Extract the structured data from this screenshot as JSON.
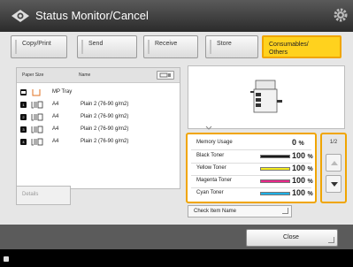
{
  "window": {
    "title": "Status Monitor/Cancel"
  },
  "tabs": [
    {
      "label": "Copy/Print"
    },
    {
      "label": "Send"
    },
    {
      "label": "Receive"
    },
    {
      "label": "Store"
    },
    {
      "label_line1": "Consumables/",
      "label_line2": "Others"
    }
  ],
  "list": {
    "headers": {
      "paper_size": "Paper Size",
      "name": "Name"
    },
    "rows": [
      {
        "num": "",
        "size": "MP Tray",
        "name": ""
      },
      {
        "num": "1",
        "size": "A4",
        "name": "Plain 2 (76-90 g/m2)"
      },
      {
        "num": "2",
        "size": "A4",
        "name": "Plain 2 (76-90 g/m2)"
      },
      {
        "num": "3",
        "size": "A4",
        "name": "Plain 2 (76-90 g/m2)"
      },
      {
        "num": "4",
        "size": "A4",
        "name": "Plain 2 (76-90 g/m2)"
      }
    ]
  },
  "details_label": "Details",
  "consumables": [
    {
      "name": "Memory Usage",
      "value": "0",
      "unit": "%",
      "color": ""
    },
    {
      "name": "Black Toner",
      "value": "100",
      "unit": "%",
      "color": "#1a1a1a"
    },
    {
      "name": "Yellow Toner",
      "value": "100",
      "unit": "%",
      "color": "#f5ec1e"
    },
    {
      "name": "Magenta Toner",
      "value": "100",
      "unit": "%",
      "color": "#e8288a"
    },
    {
      "name": "Cyan Toner",
      "value": "100",
      "unit": "%",
      "color": "#1fb0e6"
    }
  ],
  "pager": {
    "label": "1/2"
  },
  "check_item_label": "Check Item Name",
  "close_label": "Close",
  "colors": {
    "accent": "#f0a500",
    "active_tab": "#ffd21e"
  }
}
